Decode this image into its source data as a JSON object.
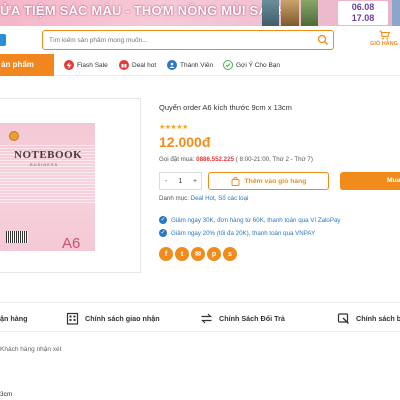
{
  "banner": {
    "text": "ỬA TIỆM SẮC MÀU - THƠM NỒNG MÙI SÁCH",
    "date_start": "06.08",
    "date_end": "17.08"
  },
  "header": {
    "search_placeholder": "Tìm kiếm sản phẩm mong muốn...",
    "cart_label": "GIỎ HÀNG"
  },
  "nav": {
    "category_label": "ản phẩm",
    "items": [
      {
        "label": "Flash Sale",
        "icon": "flash-icon",
        "color": "#e53935"
      },
      {
        "label": "Deal hot",
        "icon": "gift-icon",
        "color": "#e53935"
      },
      {
        "label": "Thành Viên",
        "icon": "member-icon",
        "color": "#2b78c2"
      },
      {
        "label": "Gợi Ý Cho Bạn",
        "icon": "suggest-icon",
        "color": "#4caf50"
      }
    ]
  },
  "product": {
    "image": {
      "brand_text": "NOTEBOOK",
      "sub_text": "BUSINESS",
      "size_text": "A6"
    },
    "title": "Quyển order A6 kích thước 9cm x 13cm",
    "rating": 5,
    "stars": "★★★★★",
    "price": "12.000đ",
    "call_prefix": "Gọi đặt mua: ",
    "call_number": "0886.552.225",
    "call_hours": " ( 8:00-21:00, Thứ 2 - Thứ 7)",
    "qty_minus": "-",
    "qty_value": "1",
    "qty_plus": "+",
    "add_to_cart": "Thêm vào giỏ hàng",
    "buy_now": "Mua",
    "category_prefix": "Danh mục: ",
    "category_links": "Deal Hot, Sổ các loại",
    "promos": [
      "Giảm ngay 30K, đơn hàng từ 60K, thanh toán qua Ví ZaloPay",
      "Giảm ngay 20% (tối đa 20K), thanh toán qua VNPAY"
    ],
    "socials": [
      {
        "icon": "facebook-icon",
        "glyph": "f"
      },
      {
        "icon": "twitter-icon",
        "glyph": "t"
      },
      {
        "icon": "email-icon",
        "glyph": "✉"
      },
      {
        "icon": "pinterest-icon",
        "glyph": "p"
      },
      {
        "icon": "skype-icon",
        "glyph": "s"
      }
    ]
  },
  "policies": [
    {
      "label": "ận hàng",
      "icon": "truck-icon"
    },
    {
      "label": "Chính sách giao nhận",
      "icon": "building-icon"
    },
    {
      "label": "Chính Sách Đổi Trả",
      "icon": "exchange-icon"
    },
    {
      "label": "Chính sách b",
      "icon": "shield-icon"
    }
  ],
  "reviews_text": "Khách hàng nhận xét",
  "bottom_text": "3cm",
  "colors": {
    "accent": "#f08c1c",
    "link": "#2b78c2",
    "price": "#f08c1c",
    "phone": "#e53935"
  }
}
